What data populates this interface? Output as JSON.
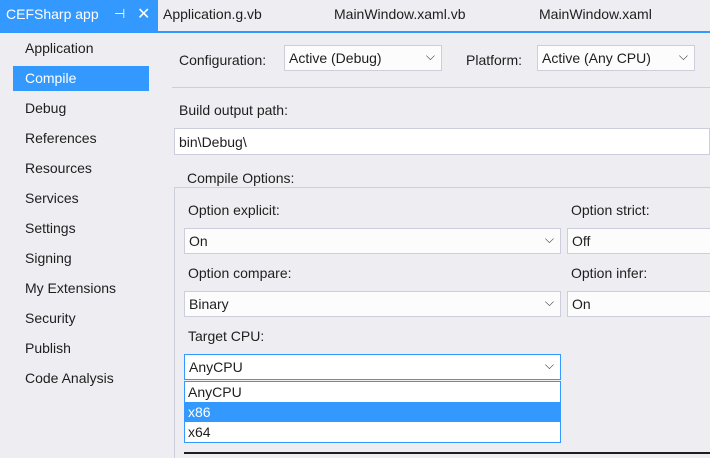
{
  "tabs": {
    "active": {
      "label": "CEFSharp app",
      "pin_icon": "pin-icon",
      "close_icon": "close-icon",
      "pin_glyph": "⊣",
      "close_glyph": "✕"
    },
    "others": [
      {
        "label": "Application.g.vb"
      },
      {
        "label": "MainWindow.xaml.vb"
      },
      {
        "label": "MainWindow.xaml"
      }
    ]
  },
  "sidebar": {
    "items": [
      {
        "label": "Application"
      },
      {
        "label": "Compile"
      },
      {
        "label": "Debug"
      },
      {
        "label": "References"
      },
      {
        "label": "Resources"
      },
      {
        "label": "Services"
      },
      {
        "label": "Settings"
      },
      {
        "label": "Signing"
      },
      {
        "label": "My Extensions"
      },
      {
        "label": "Security"
      },
      {
        "label": "Publish"
      },
      {
        "label": "Code Analysis"
      }
    ],
    "selected": "Compile"
  },
  "config": {
    "configuration_label": "Configuration:",
    "configuration_value": "Active (Debug)",
    "platform_label": "Platform:",
    "platform_value": "Active (Any CPU)"
  },
  "build": {
    "output_path_label": "Build output path:",
    "output_path_value": "bin\\Debug\\"
  },
  "compile_options": {
    "title": "Compile Options:",
    "option_explicit_label": "Option explicit:",
    "option_explicit_value": "On",
    "option_strict_label": "Option strict:",
    "option_strict_value": "Off",
    "option_compare_label": "Option compare:",
    "option_compare_value": "Binary",
    "option_infer_label": "Option infer:",
    "option_infer_value": "On",
    "target_cpu_label": "Target CPU:",
    "target_cpu_value": "AnyCPU",
    "target_cpu_options": [
      "AnyCPU",
      "x86",
      "x64"
    ],
    "target_cpu_highlighted": "x86"
  },
  "icons": {
    "chevron": "chevron-down-icon",
    "chevron_glyph": "⌵"
  },
  "colors": {
    "accent": "#3399ff",
    "background": "#eeeef2",
    "border": "#cccedb"
  }
}
